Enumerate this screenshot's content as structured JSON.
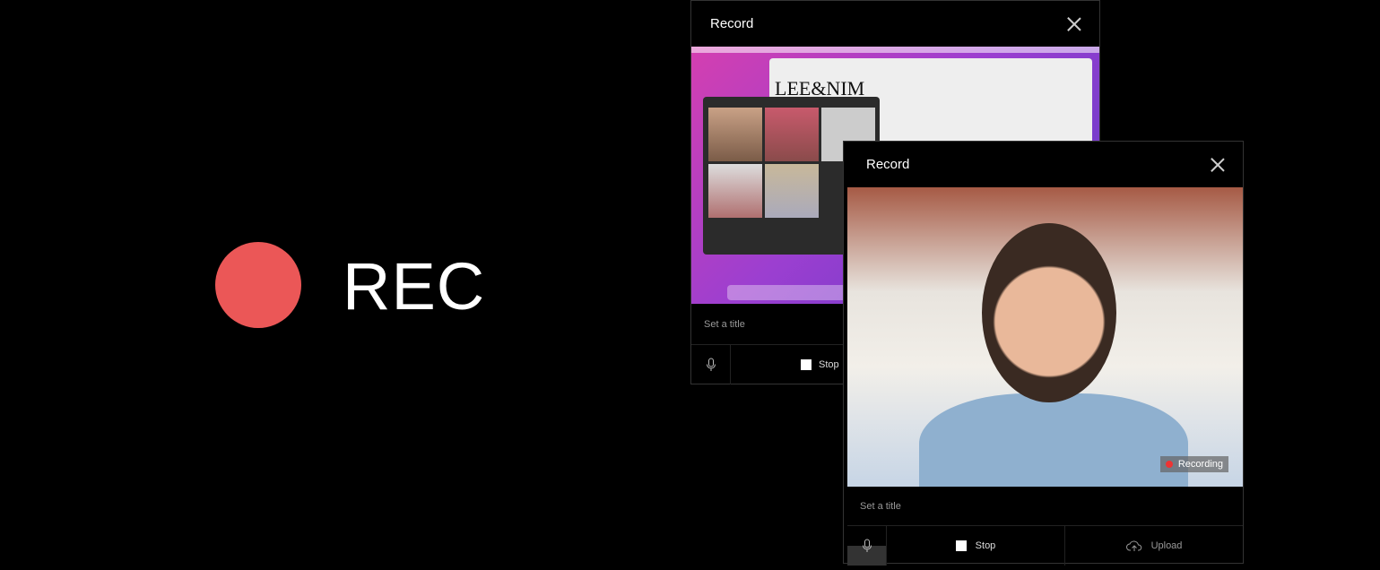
{
  "hero": {
    "label": "REC",
    "dot_color": "#eb5757"
  },
  "panel_back": {
    "title": "Record",
    "title_placeholder": "Set a title",
    "stop_label": "Stop",
    "screen_logo": "LEE&NIM"
  },
  "panel_front": {
    "title": "Record",
    "title_placeholder": "Set a title",
    "stop_label": "Stop",
    "upload_label": "Upload",
    "recording_badge": "Recording"
  }
}
